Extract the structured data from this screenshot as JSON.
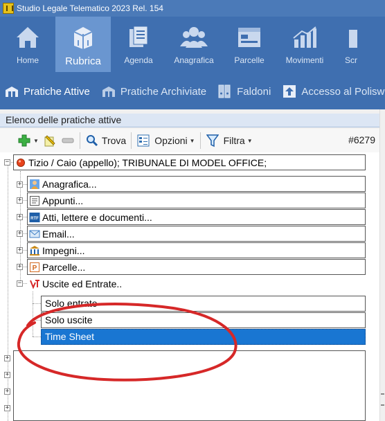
{
  "window": {
    "title": "Studio Legale Telematico 2023 Rel. 154"
  },
  "ribbon": {
    "tabs": [
      {
        "label": "Home",
        "icon": "home-icon"
      },
      {
        "label": "Rubrica",
        "icon": "box-icon",
        "active": true
      },
      {
        "label": "Agenda",
        "icon": "agenda-icon"
      },
      {
        "label": "Anagrafica",
        "icon": "people-icon"
      },
      {
        "label": "Parcelle",
        "icon": "window-icon"
      },
      {
        "label": "Movimenti",
        "icon": "bar-chart-icon"
      },
      {
        "label": "Scr",
        "icon": "partial-icon"
      }
    ]
  },
  "subtabs": [
    {
      "label": "Pratiche Attive",
      "active": true
    },
    {
      "label": "Pratiche Archiviate"
    },
    {
      "label": "Faldoni"
    },
    {
      "label": "Accesso al Polisw"
    }
  ],
  "panel": {
    "header": "Elenco delle pratiche attive"
  },
  "toolbar": {
    "find_label": "Trova",
    "options_label": "Opzioni",
    "filter_label": "Filtra",
    "counter": "#6279"
  },
  "tree": {
    "root": "Tizio / Caio (appello); TRIBUNALE DI MODEL OFFICE;",
    "children": [
      {
        "label": "Anagrafica..."
      },
      {
        "label": "Appunti..."
      },
      {
        "label": "Atti, lettere e documenti..."
      },
      {
        "label": "Email..."
      },
      {
        "label": "Impegni..."
      },
      {
        "label": "Parcelle..."
      },
      {
        "label": "Uscite ed Entrate.."
      }
    ],
    "leaves": [
      {
        "label": "Solo entrate"
      },
      {
        "label": "Solo uscite"
      },
      {
        "label": "Time Sheet",
        "selected": true
      }
    ]
  },
  "colors": {
    "ribbon": "#3f6fb0",
    "ribbon_active": "#6a96d0",
    "selection": "#1976d2",
    "annotation": "#d62828"
  }
}
